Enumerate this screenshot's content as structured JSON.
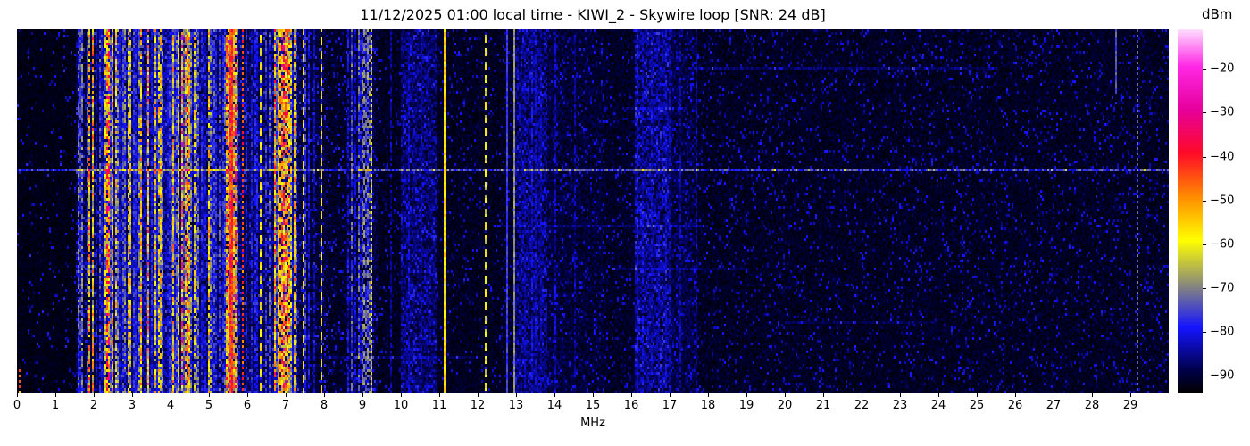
{
  "chart_data": {
    "type": "heatmap",
    "subtype": "radio-spectrogram-waterfall",
    "title": "11/12/2025 01:00 local time - KIWI_2 - Skywire loop [SNR: 24 dB]",
    "xlabel": "MHz",
    "x_range_mhz": [
      0,
      30
    ],
    "x_ticks": [
      0,
      1,
      2,
      3,
      4,
      5,
      6,
      7,
      8,
      9,
      10,
      11,
      12,
      13,
      14,
      15,
      16,
      17,
      18,
      19,
      20,
      21,
      22,
      23,
      24,
      25,
      26,
      27,
      28,
      29
    ],
    "grid": false,
    "legend": "none",
    "colorbar": {
      "label": "dBm",
      "position": "right",
      "vmin": -94,
      "vmax": -11,
      "ticks": [
        {
          "value": -20,
          "label": "−20"
        },
        {
          "value": -30,
          "label": "−30"
        },
        {
          "value": -40,
          "label": "−40"
        },
        {
          "value": -50,
          "label": "−50"
        },
        {
          "value": -60,
          "label": "−60"
        },
        {
          "value": -70,
          "label": "−70"
        },
        {
          "value": -80,
          "label": "−80"
        },
        {
          "value": -90,
          "label": "−90"
        }
      ]
    },
    "colormap_stops": [
      {
        "pos": 0.0,
        "color": "#000000"
      },
      {
        "pos": 0.06,
        "color": "#000046"
      },
      {
        "pos": 0.18,
        "color": "#1414ff"
      },
      {
        "pos": 0.3,
        "color": "#8c8c78"
      },
      {
        "pos": 0.42,
        "color": "#ffff00"
      },
      {
        "pos": 0.54,
        "color": "#ff8c00"
      },
      {
        "pos": 0.66,
        "color": "#ff0a28"
      },
      {
        "pos": 0.78,
        "color": "#e6009b"
      },
      {
        "pos": 0.9,
        "color": "#ff28e6"
      },
      {
        "pos": 1.0,
        "color": "#ffdcff"
      }
    ],
    "noise_seed": 20251112,
    "palettes": {
      "blue": [
        {
          "p": 1.0,
          "lo": 0.13,
          "hi": 0.26
        }
      ],
      "blueY": [
        {
          "p": 0.78,
          "lo": 0.13,
          "hi": 0.27
        },
        {
          "p": 0.22,
          "lo": 0.36,
          "hi": 0.48
        }
      ],
      "mixed": [
        {
          "p": 0.5,
          "lo": 0.14,
          "hi": 0.28
        },
        {
          "p": 0.36,
          "lo": 0.36,
          "hi": 0.5
        },
        {
          "p": 0.14,
          "lo": 0.5,
          "hi": 0.6
        }
      ],
      "hotY": [
        {
          "p": 0.3,
          "lo": 0.15,
          "hi": 0.28
        },
        {
          "p": 0.5,
          "lo": 0.38,
          "hi": 0.52
        },
        {
          "p": 0.2,
          "lo": 0.5,
          "hi": 0.6
        }
      ],
      "dim": [
        {
          "p": 1.0,
          "lo": 0.09,
          "hi": 0.15
        }
      ]
    },
    "bands": [
      {
        "f0": 0.0,
        "f1": 1.55,
        "base": 0.022,
        "dd": 0.05,
        "dl": 0.13,
        "sd": 0.0,
        "pal": ""
      },
      {
        "f0": 1.55,
        "f1": 2.25,
        "base": 0.055,
        "dd": 0.15,
        "dl": 0.15,
        "sd": 0.5,
        "pal": "blueY"
      },
      {
        "f0": 2.25,
        "f1": 4.65,
        "base": 0.1,
        "dd": 0.2,
        "dl": 0.16,
        "sd": 0.78,
        "pal": "mixed"
      },
      {
        "f0": 4.65,
        "f1": 5.45,
        "base": 0.08,
        "dd": 0.18,
        "dl": 0.15,
        "sd": 0.58,
        "pal": "blueY"
      },
      {
        "f0": 5.45,
        "f1": 5.8,
        "base": 0.09,
        "dd": 0.2,
        "dl": 0.16,
        "sd": 0.7,
        "pal": "hotY"
      },
      {
        "f0": 5.8,
        "f1": 6.6,
        "base": 0.07,
        "dd": 0.18,
        "dl": 0.15,
        "sd": 0.5,
        "pal": "blueY"
      },
      {
        "f0": 6.6,
        "f1": 7.1,
        "base": 0.09,
        "dd": 0.2,
        "dl": 0.16,
        "sd": 0.8,
        "pal": "hotY"
      },
      {
        "f0": 7.1,
        "f1": 7.65,
        "base": 0.06,
        "dd": 0.15,
        "dl": 0.15,
        "sd": 0.48,
        "pal": "blueY"
      },
      {
        "f0": 7.65,
        "f1": 8.1,
        "base": 0.045,
        "dd": 0.12,
        "dl": 0.14,
        "sd": 0.28,
        "pal": "blue"
      },
      {
        "f0": 8.1,
        "f1": 8.55,
        "base": 0.035,
        "dd": 0.1,
        "dl": 0.13,
        "sd": 0.08,
        "pal": "dim"
      },
      {
        "f0": 8.55,
        "f1": 9.4,
        "base": 0.05,
        "dd": 0.15,
        "dl": 0.14,
        "sd": 0.5,
        "pal": "blue"
      },
      {
        "f0": 9.4,
        "f1": 10.0,
        "base": 0.03,
        "dd": 0.08,
        "dl": 0.12,
        "sd": 0.05,
        "pal": "dim"
      },
      {
        "f0": 10.0,
        "f1": 10.95,
        "base": 0.075,
        "dd": 0.3,
        "dl": 0.13,
        "sd": 0.25,
        "pal": "dim"
      },
      {
        "f0": 10.95,
        "f1": 12.7,
        "base": 0.03,
        "dd": 0.08,
        "dl": 0.12,
        "sd": 0.0,
        "pal": ""
      },
      {
        "f0": 12.7,
        "f1": 13.0,
        "base": 0.04,
        "dd": 0.1,
        "dl": 0.12,
        "sd": 0.0,
        "pal": ""
      },
      {
        "f0": 13.0,
        "f1": 13.8,
        "base": 0.08,
        "dd": 0.3,
        "dl": 0.13,
        "sd": 0.3,
        "pal": "dim"
      },
      {
        "f0": 13.8,
        "f1": 14.3,
        "base": 0.05,
        "dd": 0.15,
        "dl": 0.12,
        "sd": 0.1,
        "pal": "dim"
      },
      {
        "f0": 14.3,
        "f1": 15.3,
        "base": 0.045,
        "dd": 0.12,
        "dl": 0.12,
        "sd": 0.05,
        "pal": "dim"
      },
      {
        "f0": 15.3,
        "f1": 16.1,
        "base": 0.035,
        "dd": 0.1,
        "dl": 0.12,
        "sd": 0.0,
        "pal": ""
      },
      {
        "f0": 16.1,
        "f1": 17.0,
        "base": 0.085,
        "dd": 0.35,
        "dl": 0.14,
        "sd": 0.3,
        "pal": "dim"
      },
      {
        "f0": 17.0,
        "f1": 17.7,
        "base": 0.055,
        "dd": 0.18,
        "dl": 0.12,
        "sd": 0.08,
        "pal": "dim"
      },
      {
        "f0": 17.7,
        "f1": 30.0,
        "base": 0.032,
        "dd": 0.1,
        "dl": 0.12,
        "sd": 0.0,
        "pal": ""
      }
    ],
    "vlines": [
      {
        "f": 0.05,
        "w": 1,
        "lvl": 0.55,
        "style": "dotted",
        "y0": 0.93,
        "y1": 1.0
      },
      {
        "f": 5.56,
        "w": 2,
        "lvl": 0.64,
        "style": "solid",
        "y0": 0.0,
        "y1": 1.0
      },
      {
        "f": 5.9,
        "w": 1,
        "lvl": 0.6,
        "style": "dotted",
        "y0": 0.0,
        "y1": 1.0
      },
      {
        "f": 6.35,
        "w": 1,
        "lvl": 0.42,
        "style": "dashed",
        "y0": 0.0,
        "y1": 1.0
      },
      {
        "f": 6.85,
        "w": 2,
        "lvl": 0.5,
        "style": "dashed",
        "y0": 0.0,
        "y1": 1.0
      },
      {
        "f": 7.45,
        "w": 1,
        "lvl": 0.42,
        "style": "dashed",
        "y0": 0.0,
        "y1": 1.0
      },
      {
        "f": 7.93,
        "w": 1,
        "lvl": 0.42,
        "style": "dashed",
        "y0": 0.0,
        "y1": 1.0
      },
      {
        "f": 9.05,
        "w": 1,
        "lvl": 0.3,
        "style": "dashed",
        "y0": 0.0,
        "y1": 1.0
      },
      {
        "f": 9.22,
        "w": 1,
        "lvl": 0.4,
        "style": "dotted",
        "y0": 0.0,
        "y1": 1.0
      },
      {
        "f": 11.15,
        "w": 1,
        "lvl": 0.44,
        "style": "solid",
        "y0": 0.0,
        "y1": 1.0
      },
      {
        "f": 12.22,
        "w": 1,
        "lvl": 0.4,
        "style": "dashed",
        "y0": 0.0,
        "y1": 1.0
      },
      {
        "f": 12.77,
        "w": 1,
        "lvl": 0.22,
        "style": "solid",
        "y0": 0.0,
        "y1": 1.0
      },
      {
        "f": 12.94,
        "w": 1,
        "lvl": 0.3,
        "style": "solid",
        "y0": 0.0,
        "y1": 1.0
      },
      {
        "f": 28.62,
        "w": 1,
        "lvl": 0.24,
        "style": "solid",
        "y0": 0.0,
        "y1": 0.18
      },
      {
        "f": 29.18,
        "w": 1,
        "lvl": 0.26,
        "style": "dotted",
        "y0": 0.0,
        "y1": 1.0
      }
    ],
    "hlines": [
      {
        "y": 0.38,
        "f0": 0.0,
        "f1": 30.0,
        "boost": 0.16
      },
      {
        "y": 0.103,
        "f0": 17.5,
        "f1": 25.5,
        "boost": 0.05
      },
      {
        "y": 0.21,
        "f0": 15.8,
        "f1": 17.4,
        "boost": 0.05
      },
      {
        "y": 0.54,
        "f0": 12.5,
        "f1": 18.0,
        "boost": 0.045
      },
      {
        "y": 0.655,
        "f0": 15.5,
        "f1": 19.0,
        "boost": 0.04
      },
      {
        "y": 0.8,
        "f0": 20.0,
        "f1": 24.0,
        "boost": 0.035
      },
      {
        "y": 0.9,
        "f0": 8.0,
        "f1": 12.0,
        "boost": 0.04
      }
    ]
  }
}
